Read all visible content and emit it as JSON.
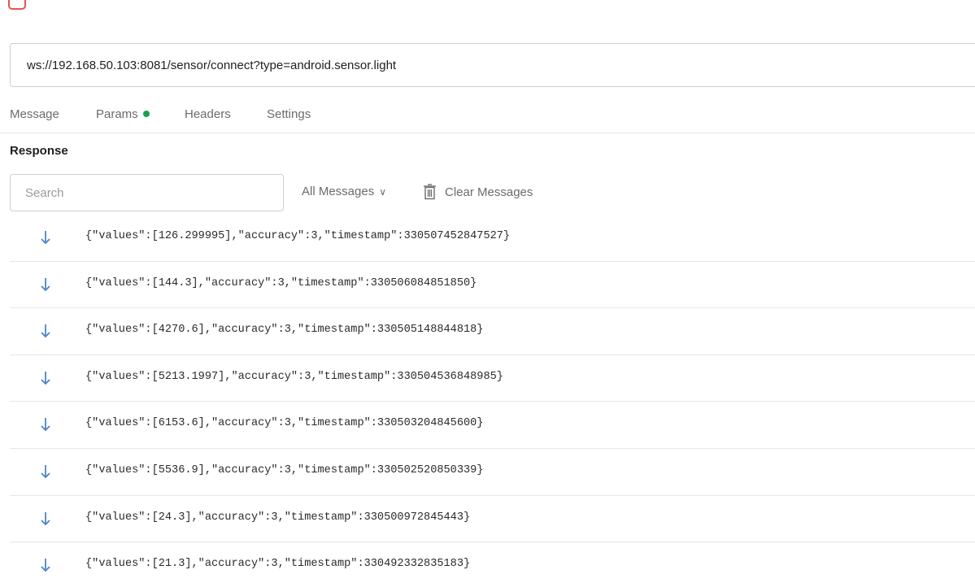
{
  "url": {
    "value": "ws://192.168.50.103:8081/sensor/connect?type=android.sensor.light"
  },
  "tabs": [
    {
      "label": "Message"
    },
    {
      "label": "Params"
    },
    {
      "label": "Headers"
    },
    {
      "label": "Settings"
    }
  ],
  "response": {
    "title": "Response",
    "search_placeholder": "Search",
    "filter_label": "All Messages",
    "clear_label": "Clear Messages"
  },
  "messages": [
    {
      "direction": "incoming",
      "text": "{\"values\":[126.299995],\"accuracy\":3,\"timestamp\":330507452847527}"
    },
    {
      "direction": "incoming",
      "text": "{\"values\":[144.3],\"accuracy\":3,\"timestamp\":330506084851850}"
    },
    {
      "direction": "incoming",
      "text": "{\"values\":[4270.6],\"accuracy\":3,\"timestamp\":330505148844818}"
    },
    {
      "direction": "incoming",
      "text": "{\"values\":[5213.1997],\"accuracy\":3,\"timestamp\":330504536848985}"
    },
    {
      "direction": "incoming",
      "text": "{\"values\":[6153.6],\"accuracy\":3,\"timestamp\":330503204845600}"
    },
    {
      "direction": "incoming",
      "text": "{\"values\":[5536.9],\"accuracy\":3,\"timestamp\":330502520850339}"
    },
    {
      "direction": "incoming",
      "text": "{\"values\":[24.3],\"accuracy\":3,\"timestamp\":330500972845443}"
    },
    {
      "direction": "incoming",
      "text": "{\"values\":[21.3],\"accuracy\":3,\"timestamp\":330492332835183}"
    }
  ],
  "colors": {
    "incoming_arrow": "#4a86c8",
    "params_indicator": "#16a34a",
    "websocket_icon": "#e0574b"
  },
  "icons": {
    "websocket": "websocket-icon",
    "incoming": "arrow-down-icon",
    "clear": "trash-icon",
    "dropdown": "chevron-down-icon"
  }
}
